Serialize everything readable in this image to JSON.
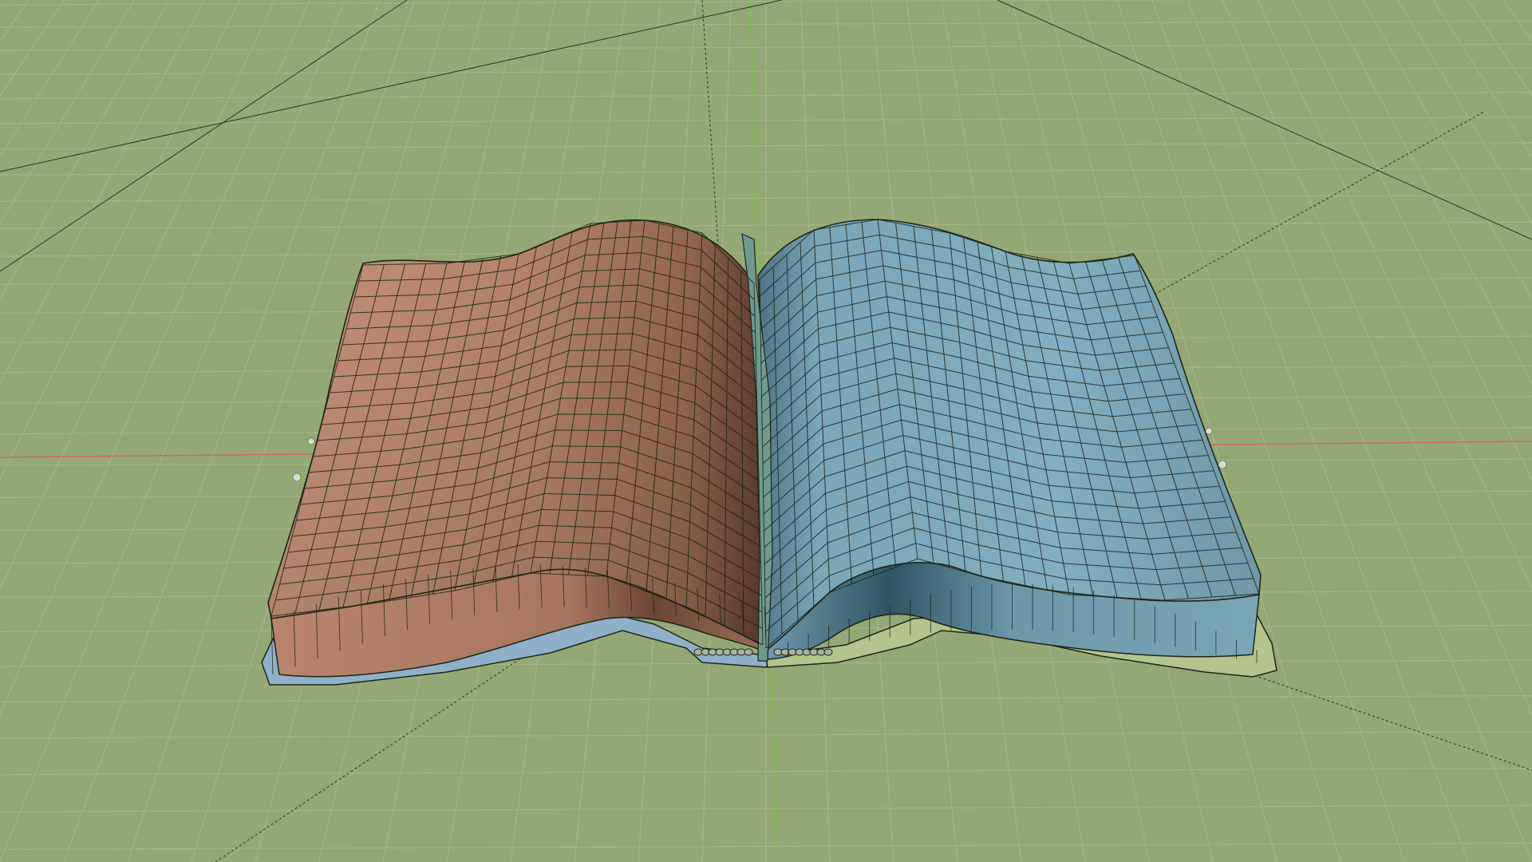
{
  "viewport": {
    "mode": "3d-viewport-wireframe-overlay",
    "background_color": "#94a876",
    "grid_color": "#a4b688",
    "x_axis_color": "#c96a63",
    "y_axis_color": "#7bc04a",
    "edge_color": "#1e2418"
  },
  "scene": {
    "object": "open-book-model",
    "left_pages_color": "#b0826c",
    "right_pages_color": "#7aa9b9",
    "cover_blue_color": "#8fb0c8",
    "cover_green_color": "#b4c48c",
    "bookmark_color": "#6f9a90"
  },
  "icons": [
    "light-point-icon",
    "camera-helper-line-icon"
  ]
}
